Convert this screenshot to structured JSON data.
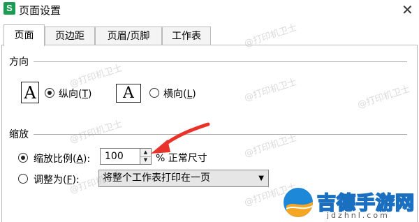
{
  "window": {
    "app_icon_letter": "S",
    "title": "页面设置",
    "close_glyph": "✕"
  },
  "tabs": [
    {
      "label": "页面",
      "active": true
    },
    {
      "label": "页边距",
      "active": false
    },
    {
      "label": "页眉/页脚",
      "active": false
    },
    {
      "label": "工作表",
      "active": false
    }
  ],
  "orientation": {
    "section_label": "方向",
    "icon_glyph": "A",
    "portrait": {
      "label_main": "纵向(",
      "label_key": "T",
      "label_end": ")",
      "selected": true
    },
    "landscape": {
      "label_main": "横向(",
      "label_key": "L",
      "label_end": ")",
      "selected": false
    }
  },
  "scaling": {
    "section_label": "缩放",
    "scale_option": {
      "label_main": "缩放比例(",
      "label_key": "A",
      "label_end": "):",
      "selected": true
    },
    "scale_value": "100",
    "scale_suffix": "% 正常尺寸",
    "fit_option": {
      "label_main": "调整为(",
      "label_key": "F",
      "label_end": "):",
      "selected": false
    },
    "fit_select_value": "将整个工作表打印在一页"
  },
  "annotation": {
    "arrow_color": "#e8322a"
  },
  "watermark_text": "@打印机卫士",
  "brand": {
    "name": "吉德手游网",
    "url": "jdzhnl.com"
  }
}
